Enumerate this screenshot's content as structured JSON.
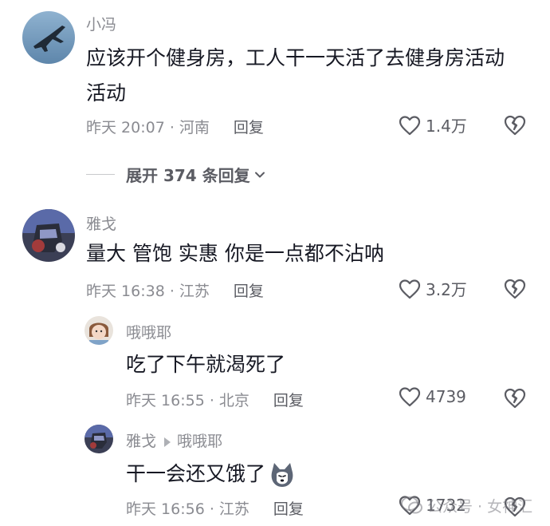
{
  "comments": [
    {
      "user": "小冯",
      "text_line1": "应该开个健身房，工人干一天活了去健身房活动",
      "text_line2": "活动",
      "time_location": "昨天 20:07 · 河南",
      "reply": "回复",
      "likes": "1.4万"
    },
    {
      "user": "雅戈",
      "text": "量大 管饱 实惠 你是一点都不沾呐",
      "time_location": "昨天 16:38 · 江苏",
      "reply": "回复",
      "likes": "3.2万"
    }
  ],
  "expand_replies": "展开 374 条回复",
  "replies": [
    {
      "user": "哦哦耶",
      "text": "吃了下午就渴死了",
      "time_location": "昨天 16:55 · 北京",
      "reply": "回复",
      "likes": "4739"
    },
    {
      "user": "雅戈",
      "reply_to": "哦哦耶",
      "text": "干一会还又饿了",
      "time_location": "昨天 16:56 · 江苏",
      "reply": "回复",
      "likes": "1732"
    }
  ],
  "watermark": "公众号 · 女神汇",
  "icons": {
    "like": "heart-outline-icon",
    "dislike": "broken-heart-icon",
    "expand": "chevron-down-icon",
    "emoji": "husky-emoji-icon"
  }
}
